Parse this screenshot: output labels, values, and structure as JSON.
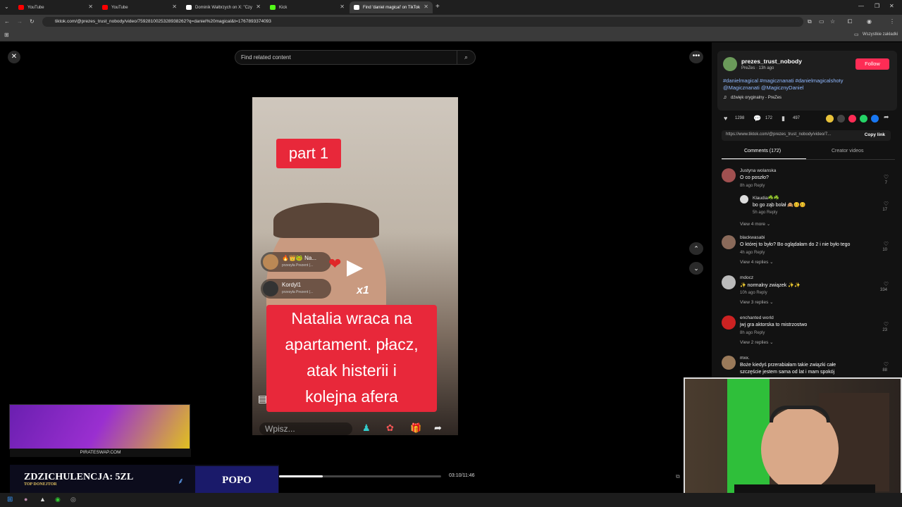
{
  "browser": {
    "tabs": [
      {
        "label": "YouTube",
        "color": "#ff0000"
      },
      {
        "label": "YouTube",
        "color": "#ff0000"
      },
      {
        "label": "Dominik Wałbrzych on X: \"Czy",
        "color": "#ffffff"
      },
      {
        "label": "Kick",
        "color": "#53fc18"
      },
      {
        "label": "Find 'daniel magical' on TikTok",
        "color": "#ffffff"
      }
    ],
    "url": "tiktok.com/@prezes_trust_nobody/video/7592810025328938262?q=daniel%20magical&t=1767893374093",
    "bookmarks_label": "Wszystkie zakładki"
  },
  "search": {
    "placeholder": "Find related content"
  },
  "video": {
    "part_label": "part 1",
    "caption_lines": [
      "Natalia wraca na",
      "apartament. płacz,",
      "atak histerii i",
      "kolejna afera"
    ],
    "gift1_name": "🔥👑🐸 Na...",
    "gift1_sub": "przesyła Prezent (...",
    "gift2_name": "Kordyl1",
    "gift2_sub": "przesyła Prezent (...",
    "gift_count": "x1",
    "input_placeholder": "Wpisz...",
    "time": "03:10/11:46",
    "progress": 0.27
  },
  "author": {
    "username": "prezes_trust_nobody",
    "subline": "PreZes · 13h ago",
    "follow_label": "Follow",
    "tags_line1": "#danielmagical #magicznanati #danielmagicalshoty",
    "tags_line2": "@Magicznanati @MagicznyDaniel",
    "sound": "dźwięk oryginalny - PreZes"
  },
  "stats": {
    "likes": "1298",
    "comments": "172",
    "saves": "497"
  },
  "share": {
    "link": "https://www.tiktok.com/@prezes_trust_nobody/video/7...",
    "copy_label": "Copy link"
  },
  "tabs": {
    "comments": "Comments (172)",
    "creator": "Creator videos"
  },
  "comments": [
    {
      "name": "Justyna wolanska",
      "text": "O co poszło?",
      "meta": "8h ago    Reply",
      "likes": "7",
      "view": "",
      "color": "#a05050"
    },
    {
      "name": "Klaudia☘️☘️",
      "text": "bo go ząb bolał 🙈🥴🥴",
      "meta": "5h ago    Reply",
      "likes": "17",
      "view": "View 4 more ⌄",
      "color": "#dddddd",
      "reply": true
    },
    {
      "name": "blackwasabi",
      "text": "O której to było? Bo oglądałam do 2 i nie było tego",
      "meta": "4h ago    Reply",
      "likes": "10",
      "view": "View 4 replies ⌄",
      "color": "#8a6a5a"
    },
    {
      "name": "mdocz",
      "text": "✨ normalny związek ✨✨",
      "meta": "10h ago    Reply",
      "likes": "334",
      "view": "View 3 replies ⌄",
      "color": "#bbbbbb"
    },
    {
      "name": "enchanted world",
      "text": "jwj gra aktorska to mistrzostwo",
      "meta": "8h ago    Reply",
      "likes": "23",
      "view": "View 2 replies ⌄",
      "color": "#cc2222"
    },
    {
      "name": "mxx.",
      "text": "Boże kiedyś przerabiałam takie związki całe",
      "text2": "szczęście jestem sama od lat i mam spokój",
      "meta": "",
      "likes": "88",
      "view": "",
      "color": "#9a7a5a"
    }
  ],
  "stream": {
    "donate_label": "ZDZICHULENCJA: 5ZL",
    "donate_sub": "TOP DONEJTOR",
    "name": "POPO",
    "ad_text": "PIRATESWAP.COM"
  }
}
